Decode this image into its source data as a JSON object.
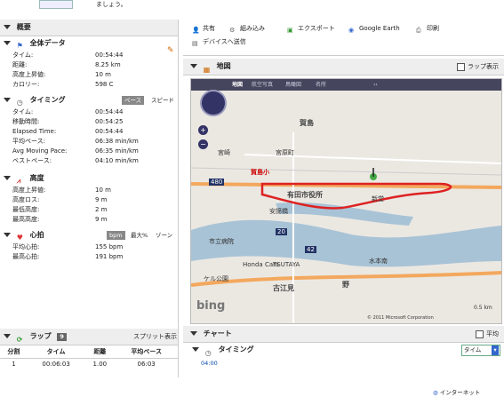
{
  "top": {
    "note": "ましょう。"
  },
  "overview": {
    "title": "概要",
    "overall": {
      "title": "全体データ",
      "rows": [
        {
          "label": "タイム:",
          "value": "00:54:44"
        },
        {
          "label": "距離:",
          "value": "8.25 km"
        },
        {
          "label": "高度上昇値:",
          "value": "10 m"
        },
        {
          "label": "カロリー:",
          "value": "598 C"
        }
      ]
    },
    "timing": {
      "title": "タイミング",
      "toggle_pace": "ペース",
      "toggle_speed": "スピード",
      "rows": [
        {
          "label": "タイム:",
          "value": "00:54:44"
        },
        {
          "label": "移動時間:",
          "value": "00:54:25"
        },
        {
          "label": "Elapsed Time:",
          "value": "00:54:44"
        },
        {
          "label": "平均ペース:",
          "value": "06:38 min/km"
        },
        {
          "label": "Avg Moving Pace:",
          "value": "06:35 min/km"
        },
        {
          "label": "ベストペース:",
          "value": "04:10 min/km"
        }
      ]
    },
    "elevation": {
      "title": "高度",
      "rows": [
        {
          "label": "高度上昇値:",
          "value": "10 m"
        },
        {
          "label": "高度ロス:",
          "value": "9 m"
        },
        {
          "label": "最低高度:",
          "value": "2 m"
        },
        {
          "label": "最高高度:",
          "value": "9 m"
        }
      ]
    },
    "heart": {
      "title": "心拍",
      "toggle_bpm": "bpm",
      "toggle_max": "最大%",
      "toggle_zone": "ゾーン",
      "rows": [
        {
          "label": "平均心拍:",
          "value": "155 bpm"
        },
        {
          "label": "最高心拍:",
          "value": "191 bpm"
        }
      ]
    }
  },
  "laps": {
    "title": "ラップ",
    "count": "9",
    "split_link": "スプリット表示",
    "columns": [
      "分割",
      "タイム",
      "距離",
      "平均ペース"
    ],
    "rows": [
      [
        "1",
        "00:06:03",
        "1.00",
        "06:03"
      ]
    ]
  },
  "toolbar": {
    "share": "共有",
    "embed": "組み込み",
    "export": "エクスポート",
    "google_earth": "Google Earth",
    "print": "印刷",
    "send_device": "デバイスへ送信"
  },
  "map": {
    "title": "地図",
    "lap_display": "ラップ表示",
    "tabs": [
      "地図",
      "航空写真",
      "鳥瞰図",
      "名所"
    ],
    "labels": {
      "l1": "賀島",
      "l2": "賀島小",
      "l3": "有田市役所",
      "l4": "新堂",
      "l5": "安諦橋",
      "l6": "市立病院",
      "l7": "古江見",
      "l8": "野",
      "l9": "宮原町",
      "l10": "Honda Cars",
      "l11": "TSUTAYA",
      "l12": "水本南",
      "l13": "宮崎",
      "l14": "ケル公園",
      "scale": "0.5 km",
      "road1": "480",
      "road2": "20",
      "road3": "42",
      "copyright": "© 2011 Microsoft Corporation",
      "bing": "bing"
    }
  },
  "chart": {
    "title": "チャート",
    "avg_label": "平均",
    "timing_title": "タイミング",
    "select_value": "タイム",
    "y_label": "04:00"
  },
  "status": {
    "text": "インターネット"
  }
}
